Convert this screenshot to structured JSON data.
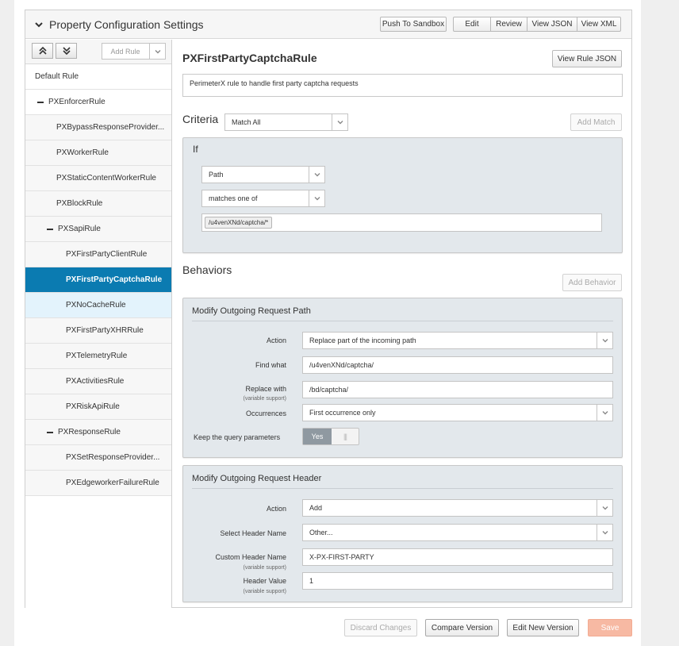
{
  "header": {
    "title": "Property Configuration Settings",
    "buttons": {
      "push_to_sandbox": "Push To Sandbox",
      "edit": "Edit",
      "review": "Review",
      "view_json": "View JSON",
      "view_xml": "View XML"
    }
  },
  "sidebar": {
    "add_rule_label": "Add Rule",
    "rules": [
      {
        "label": "Default Rule"
      },
      {
        "label": "PXEnforcerRule"
      },
      {
        "label": "PXBypassResponseProvider..."
      },
      {
        "label": "PXWorkerRule"
      },
      {
        "label": "PXStaticContentWorkerRule"
      },
      {
        "label": "PXBlockRule"
      },
      {
        "label": "PXSapiRule"
      },
      {
        "label": "PXFirstPartyClientRule"
      },
      {
        "label": "PXFirstPartyCaptchaRule"
      },
      {
        "label": "PXNoCacheRule"
      },
      {
        "label": "PXFirstPartyXHRRule"
      },
      {
        "label": "PXTelemetryRule"
      },
      {
        "label": "PXActivitiesRule"
      },
      {
        "label": "PXRiskApiRule"
      },
      {
        "label": "PXResponseRule"
      },
      {
        "label": "PXSetResponseProvider..."
      },
      {
        "label": "PXEdgeworkerFailureRule"
      }
    ]
  },
  "rule": {
    "title": "PXFirstPartyCaptchaRule",
    "view_rule_json": "View Rule JSON",
    "description": "PerimeterX rule to handle first party captcha requests"
  },
  "criteria": {
    "title": "Criteria",
    "match_mode": "Match All",
    "add_match": "Add Match",
    "if_label": "If",
    "field": "Path",
    "operator": "matches one of",
    "value_tag": "/u4venXNd/captcha/*"
  },
  "behaviors": {
    "title": "Behaviors",
    "add_behavior": "Add Behavior",
    "path": {
      "title": "Modify Outgoing Request Path",
      "action_label": "Action",
      "action_value": "Replace part of the incoming path",
      "find_label": "Find what",
      "find_value": "/u4venXNd/captcha/",
      "replace_label": "Replace with",
      "replace_sub": "(variable support)",
      "replace_value": "/bd/captcha/",
      "occurrences_label": "Occurrences",
      "occurrences_value": "First occurrence only",
      "keep_query_label": "Keep the query parameters",
      "keep_query_value": "Yes",
      "toggle_grip": "|||"
    },
    "header": {
      "title": "Modify Outgoing Request Header",
      "action_label": "Action",
      "action_value": "Add",
      "select_name_label": "Select Header Name",
      "select_name_value": "Other...",
      "custom_name_label": "Custom Header Name",
      "custom_name_sub": "(variable support)",
      "custom_name_value": "X-PX-FIRST-PARTY",
      "header_value_label": "Header Value",
      "header_value_sub": "(variable support)",
      "header_value_value": "1"
    }
  },
  "footer": {
    "discard": "Discard Changes",
    "compare": "Compare Version",
    "edit_new": "Edit New Version",
    "save": "Save"
  },
  "icons": {
    "collapse": "chevron-down-icon",
    "expand_all": "chevron-double-up-icon",
    "collapse_all": "chevron-double-down-icon",
    "dropdown": "chevron-down-icon"
  },
  "colors": {
    "selected": "#0b7bb1",
    "hover": "#e3f3fc",
    "save": "#f7b9a3"
  }
}
